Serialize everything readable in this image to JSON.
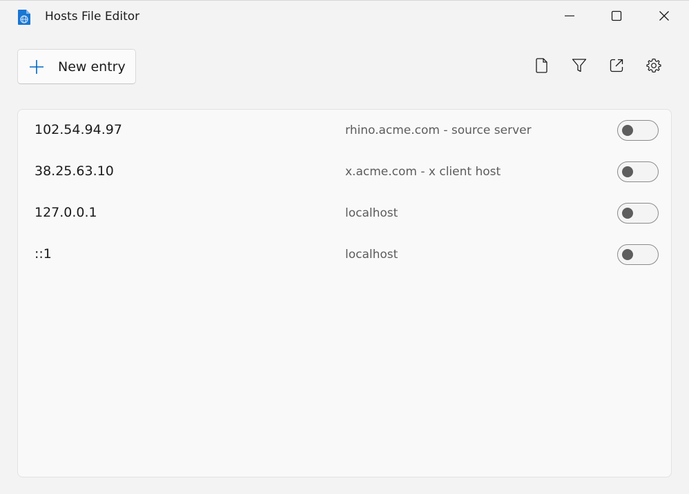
{
  "window": {
    "title": "Hosts File Editor"
  },
  "toolbar": {
    "new_entry_label": "New entry"
  },
  "icons": {
    "app": "hosts-file-icon",
    "minimize": "minimize-icon",
    "maximize": "maximize-icon",
    "close": "close-icon",
    "plus": "plus-icon",
    "file": "file-icon",
    "filter": "filter-icon",
    "open": "open-external-icon",
    "settings": "gear-icon"
  },
  "colors": {
    "accent": "#0067c0",
    "background": "#f3f3f3",
    "panel": "#f9f9f9"
  },
  "entries": [
    {
      "address": "102.54.94.97",
      "hosts": "rhino.acme.com - source server",
      "enabled": false
    },
    {
      "address": "38.25.63.10",
      "hosts": "x.acme.com - x client host",
      "enabled": false
    },
    {
      "address": "127.0.0.1",
      "hosts": "localhost",
      "enabled": false
    },
    {
      "address": "::1",
      "hosts": "localhost",
      "enabled": false
    }
  ]
}
